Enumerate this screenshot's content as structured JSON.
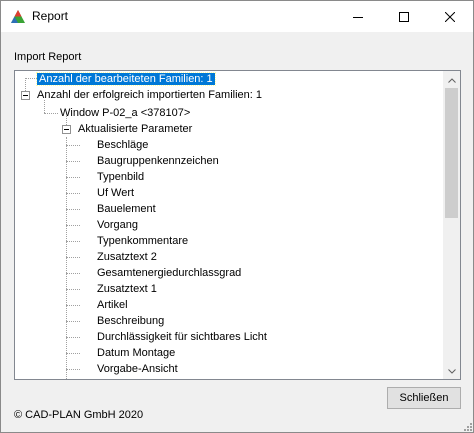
{
  "window": {
    "title": "Report",
    "icon": "cad-plan-logo-icon",
    "controls": [
      "minimize-icon",
      "maximize-icon",
      "close-icon"
    ]
  },
  "import_label": "Import Report",
  "tree": {
    "root1": "Anzahl der bearbeiteten Familien: 1",
    "root2": "Anzahl der erfolgreich importierten Familien: 1",
    "child": "Window P-02_a <378107>",
    "group": "Aktualisierte Parameter",
    "params": [
      "Beschläge",
      "Baugruppenkennzeichen",
      "Typenbild",
      "Uf Wert",
      "Bauelement",
      "Vorgang",
      "Typenkommentare",
      "Zusatztext 2",
      "Gesamtenergiedurchlassgrad",
      "Zusatztext 1",
      "Artikel",
      "Beschreibung",
      "Durchlässigkeit für sichtbares Licht",
      "Datum Montage",
      "Vorgabe-Ansicht"
    ]
  },
  "buttons": {
    "close": "Schließen"
  },
  "copyright": "© CAD-PLAN GmbH 2020",
  "colors": {
    "selection": "#0078d7",
    "background": "#f0f0f0"
  }
}
